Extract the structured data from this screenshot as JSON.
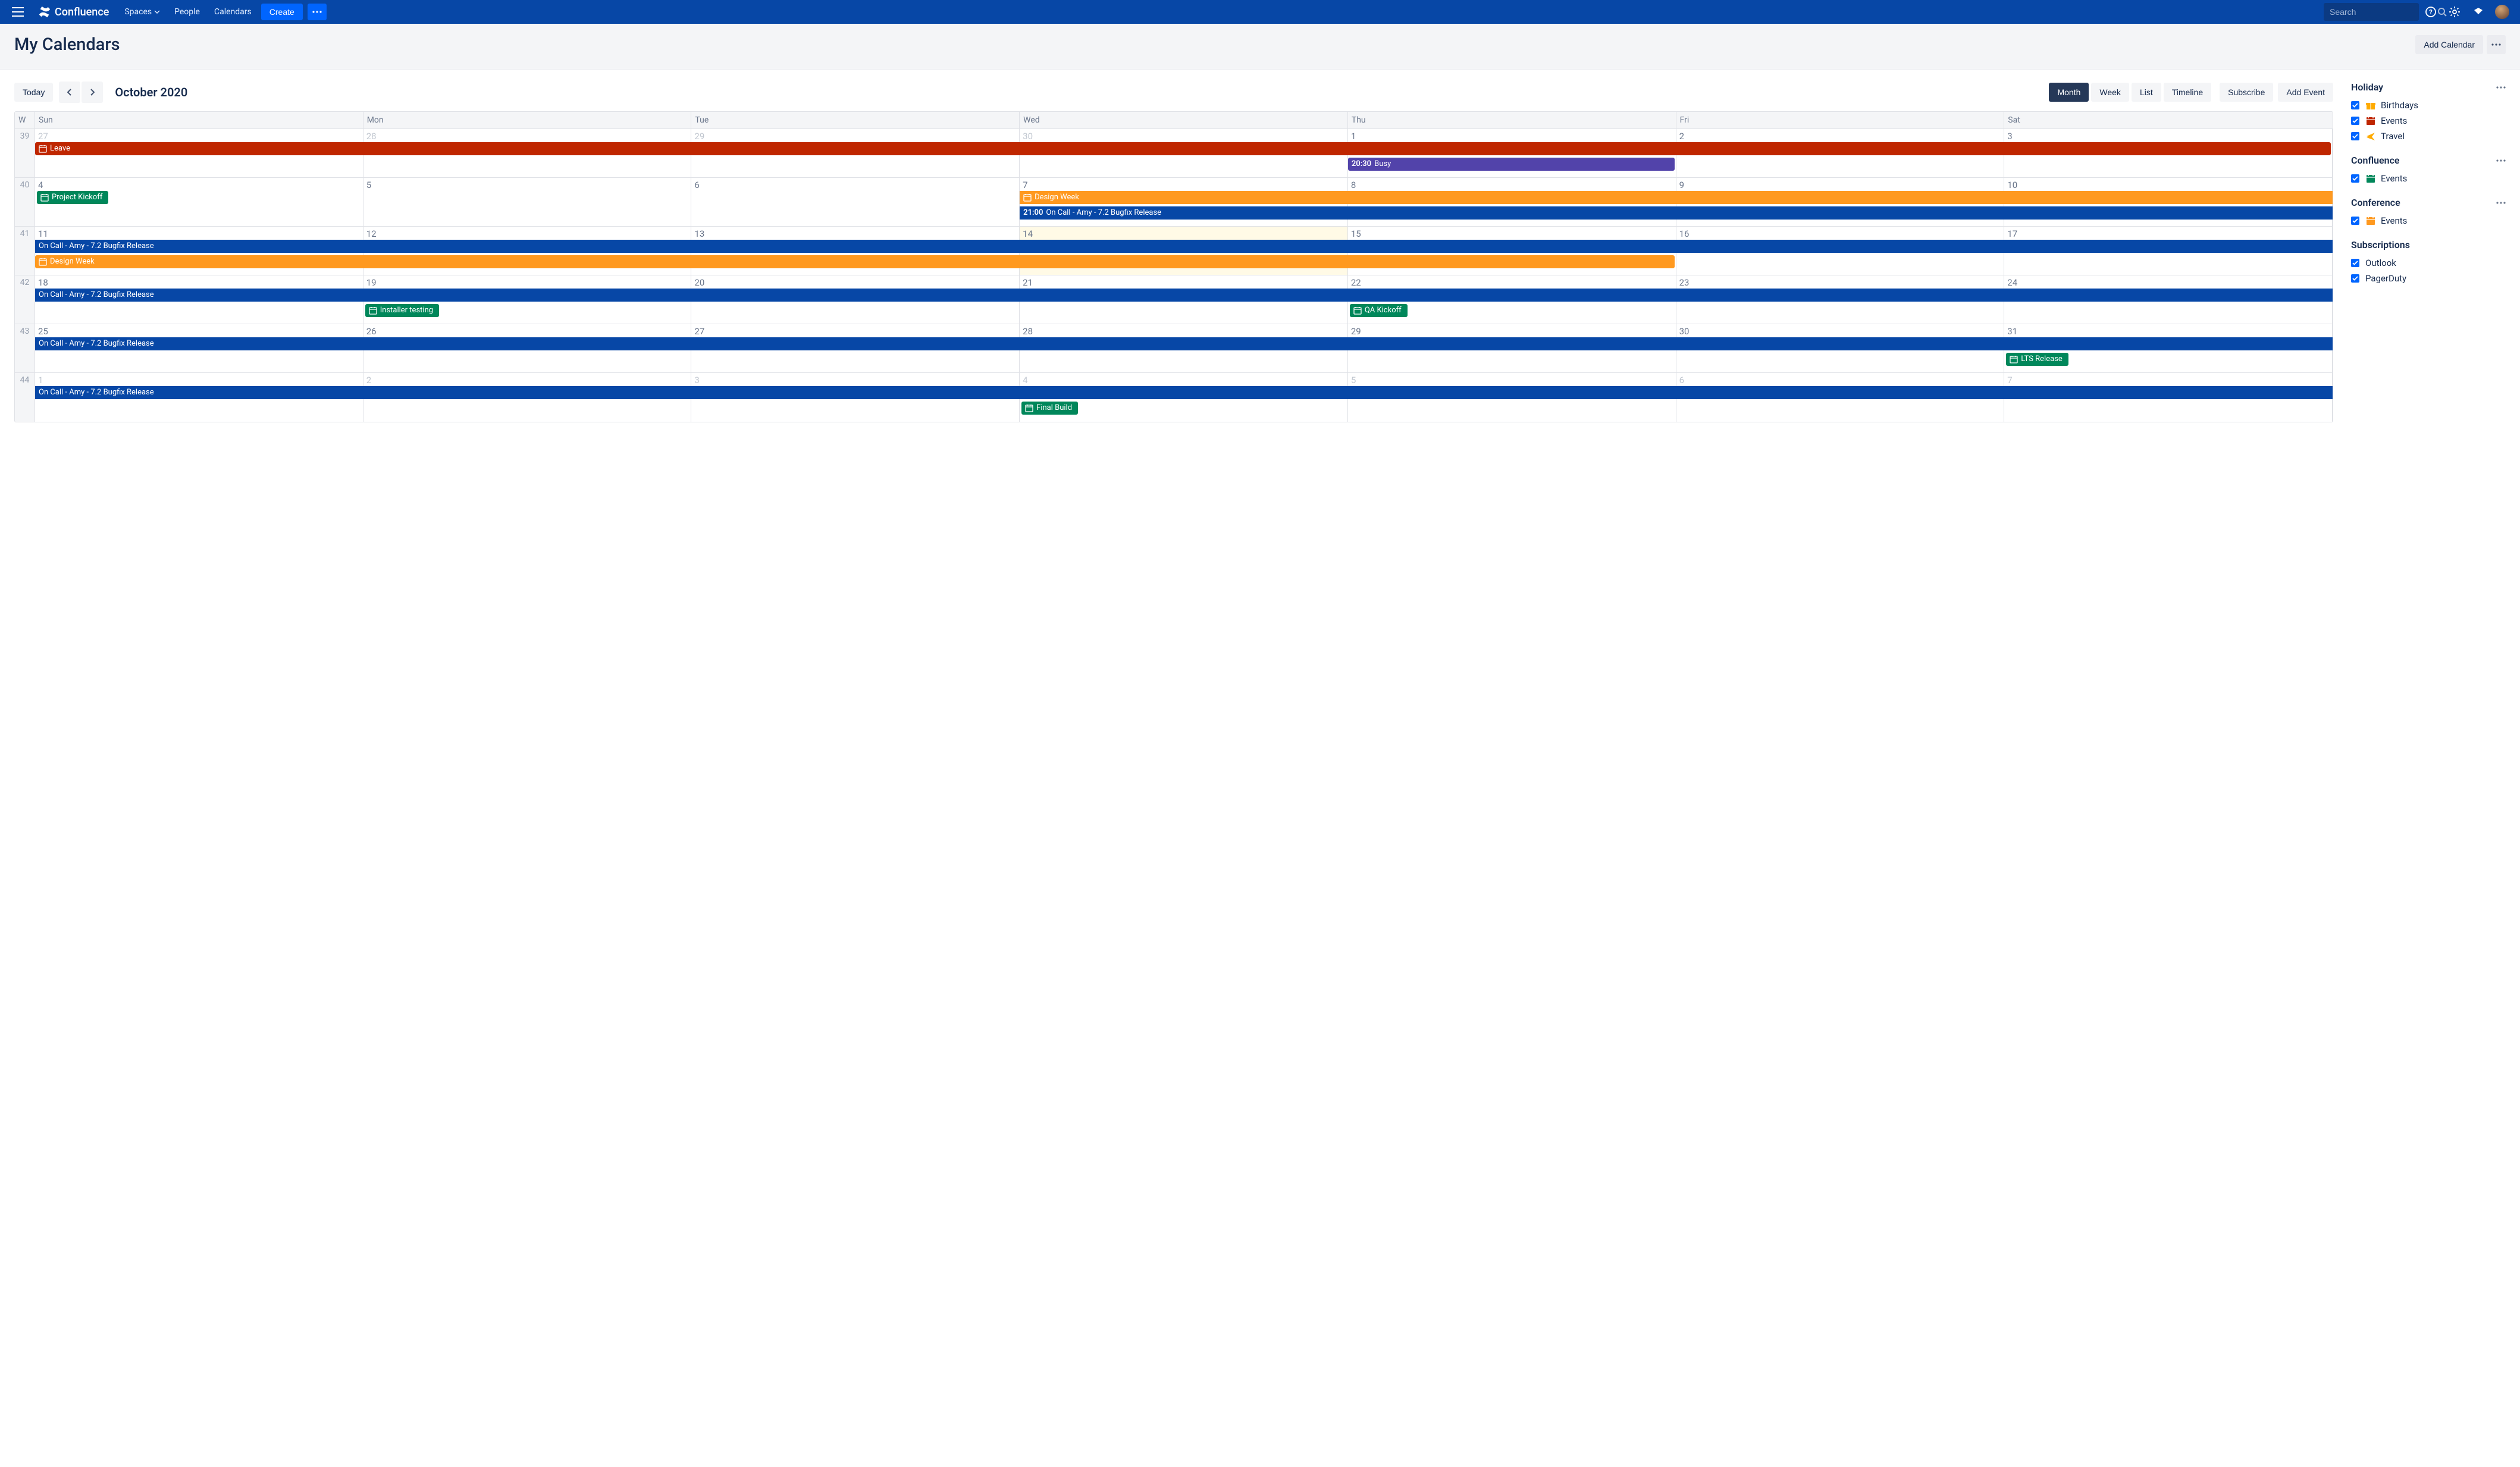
{
  "nav": {
    "brand": "Confluence",
    "spaces": "Spaces",
    "people": "People",
    "calendars": "Calendars",
    "create": "Create",
    "search_placeholder": "Search"
  },
  "header": {
    "title": "My Calendars",
    "add_calendar": "Add Calendar"
  },
  "toolbar": {
    "today": "Today",
    "month_label": "October 2020",
    "views": {
      "month": "Month",
      "week": "Week",
      "list": "List",
      "timeline": "Timeline"
    },
    "subscribe": "Subscribe",
    "add_event": "Add Event"
  },
  "day_headers": [
    "W",
    "Sun",
    "Mon",
    "Tue",
    "Wed",
    "Thu",
    "Fri",
    "Sat"
  ],
  "weeks": [
    {
      "wnum": "39",
      "days": [
        {
          "n": "27",
          "other": true
        },
        {
          "n": "28",
          "other": true
        },
        {
          "n": "29",
          "other": true
        },
        {
          "n": "30",
          "other": true
        },
        {
          "n": "1"
        },
        {
          "n": "2"
        },
        {
          "n": "3"
        }
      ],
      "events": [
        {
          "title": "Leave",
          "icon": true,
          "color": "c-red",
          "startCol": 0,
          "span": 7,
          "row": 0,
          "rounded": true
        },
        {
          "title": "Busy",
          "time": "20:30",
          "color": "c-purple",
          "startCol": 4,
          "span": 1,
          "row": 1,
          "rounded": true
        }
      ]
    },
    {
      "wnum": "40",
      "days": [
        {
          "n": "4"
        },
        {
          "n": "5"
        },
        {
          "n": "6"
        },
        {
          "n": "7"
        },
        {
          "n": "8"
        },
        {
          "n": "9"
        },
        {
          "n": "10"
        }
      ],
      "events": [
        {
          "title": "Project Kickoff",
          "icon": true,
          "color": "c-green",
          "startCol": 0,
          "span": 1,
          "row": 0,
          "rounded": true,
          "fit": true
        },
        {
          "title": "Design Week",
          "icon": true,
          "color": "c-orange",
          "startCol": 3,
          "span": 4,
          "row": 0
        },
        {
          "title": "On Call - Amy - 7.2 Bugfix Release",
          "time": "21:00",
          "color": "c-blue",
          "startCol": 3,
          "span": 4,
          "row": 1
        }
      ]
    },
    {
      "wnum": "41",
      "days": [
        {
          "n": "11"
        },
        {
          "n": "12"
        },
        {
          "n": "13"
        },
        {
          "n": "14",
          "today": true
        },
        {
          "n": "15"
        },
        {
          "n": "16"
        },
        {
          "n": "17"
        }
      ],
      "events": [
        {
          "title": "On Call - Amy - 7.2 Bugfix Release",
          "color": "c-blue",
          "startCol": 0,
          "span": 7,
          "row": 0
        },
        {
          "title": "Design Week",
          "icon": true,
          "color": "c-orange",
          "startCol": 0,
          "span": 5,
          "row": 1,
          "rounded": true
        }
      ]
    },
    {
      "wnum": "42",
      "days": [
        {
          "n": "18"
        },
        {
          "n": "19"
        },
        {
          "n": "20"
        },
        {
          "n": "21"
        },
        {
          "n": "22"
        },
        {
          "n": "23"
        },
        {
          "n": "24"
        }
      ],
      "events": [
        {
          "title": "On Call - Amy - 7.2 Bugfix Release",
          "color": "c-blue",
          "startCol": 0,
          "span": 7,
          "row": 0
        },
        {
          "title": "Installer testing",
          "icon": true,
          "color": "c-green",
          "startCol": 1,
          "span": 1,
          "row": 1,
          "rounded": true,
          "fit": true
        },
        {
          "title": "QA Kickoff",
          "icon": true,
          "color": "c-green",
          "startCol": 4,
          "span": 1,
          "row": 1,
          "rounded": true,
          "fit": true
        }
      ]
    },
    {
      "wnum": "43",
      "days": [
        {
          "n": "25"
        },
        {
          "n": "26"
        },
        {
          "n": "27"
        },
        {
          "n": "28"
        },
        {
          "n": "29"
        },
        {
          "n": "30"
        },
        {
          "n": "31"
        }
      ],
      "events": [
        {
          "title": "On Call - Amy - 7.2 Bugfix Release",
          "color": "c-blue",
          "startCol": 0,
          "span": 7,
          "row": 0
        },
        {
          "title": "LTS Release",
          "icon": true,
          "color": "c-green",
          "startCol": 6,
          "span": 1,
          "row": 1,
          "rounded": true,
          "fit": true
        }
      ]
    },
    {
      "wnum": "44",
      "days": [
        {
          "n": "1",
          "other": true
        },
        {
          "n": "2",
          "other": true
        },
        {
          "n": "3",
          "other": true
        },
        {
          "n": "4",
          "other": true
        },
        {
          "n": "5",
          "other": true
        },
        {
          "n": "6",
          "other": true
        },
        {
          "n": "7",
          "other": true
        }
      ],
      "events": [
        {
          "title": "On Call - Amy - 7.2 Bugfix Release",
          "color": "c-blue",
          "startCol": 0,
          "span": 7,
          "row": 0
        },
        {
          "title": "Final Build",
          "icon": true,
          "color": "c-green",
          "startCol": 3,
          "span": 1,
          "row": 1,
          "rounded": true,
          "fit": true
        }
      ]
    }
  ],
  "sidebar": {
    "sections": [
      {
        "title": "Holiday",
        "more": true,
        "items": [
          {
            "label": "Birthdays",
            "icon": "gift",
            "color": "#ffab00"
          },
          {
            "label": "Events",
            "icon": "calendar",
            "color": "#bf2600"
          },
          {
            "label": "Travel",
            "icon": "plane",
            "color": "#ffab00"
          }
        ]
      },
      {
        "title": "Confluence",
        "more": true,
        "items": [
          {
            "label": "Events",
            "icon": "calendar",
            "color": "#00875a"
          }
        ]
      },
      {
        "title": "Conference",
        "more": true,
        "items": [
          {
            "label": "Events",
            "icon": "calendar",
            "color": "#ff991f"
          }
        ]
      },
      {
        "title": "Subscriptions",
        "more": false,
        "items": [
          {
            "label": "Outlook"
          },
          {
            "label": "PagerDuty"
          }
        ]
      }
    ]
  }
}
